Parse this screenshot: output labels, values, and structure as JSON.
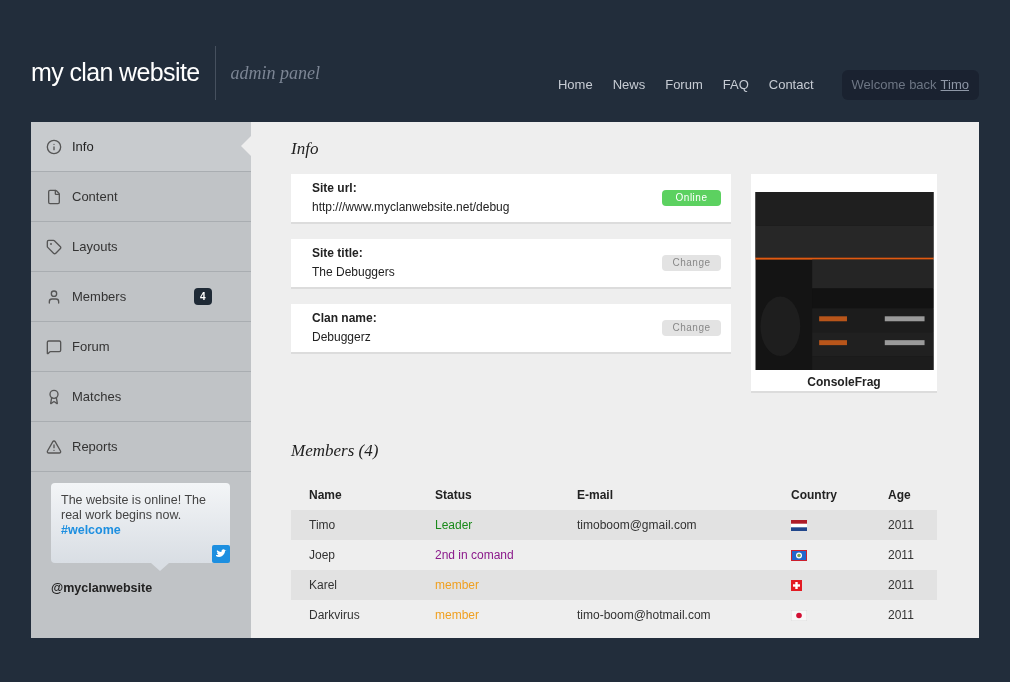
{
  "header": {
    "logo": {
      "prefix": "my",
      "bold": "clan",
      "suffix": "website"
    },
    "subtitle": "admin panel",
    "nav": [
      "Home",
      "News",
      "Forum",
      "FAQ",
      "Contact"
    ],
    "welcome": {
      "text": "Welcome back",
      "user": "Timo"
    }
  },
  "sidebar": {
    "items": [
      {
        "label": "Info",
        "selected": true
      },
      {
        "label": "Content",
        "selected": false
      },
      {
        "label": "Layouts",
        "selected": false
      },
      {
        "label": "Members",
        "selected": false,
        "badge": "4"
      },
      {
        "label": "Forum",
        "selected": false
      },
      {
        "label": "Matches",
        "selected": false
      },
      {
        "label": "Reports",
        "selected": false
      }
    ],
    "tweet": {
      "text": "The website is online! The real work begins now.",
      "hashtag": "#welcome",
      "handle": "@myclanwebsite"
    }
  },
  "info": {
    "title": "Info",
    "fields": [
      {
        "label": "Site url:",
        "value": "http:///www.myclanwebsite.net/debug",
        "action": "Online",
        "kind": "status"
      },
      {
        "label": "Site title:",
        "value": "The Debuggers",
        "action": "Change",
        "kind": "button"
      },
      {
        "label": "Clan name:",
        "value": "Debuggerz",
        "action": "Change",
        "kind": "button"
      }
    ],
    "preview": {
      "caption": "ConsoleFrag",
      "kind": "picture"
    }
  },
  "members": {
    "title": "Members (4)",
    "columns": [
      "Name",
      "Status",
      "E-mail",
      "Country",
      "Age"
    ],
    "rows": [
      {
        "name": "Timo",
        "status": "Leader",
        "color": "#1a8a1a",
        "email": "timoboom@gmail.com",
        "age": "2011"
      },
      {
        "name": "Joep",
        "status": "2nd in comand",
        "color": "#8b1a8b",
        "email": "",
        "age": "2011"
      },
      {
        "name": "Karel",
        "status": "member",
        "color": "#f0a020",
        "email": "",
        "age": "2011"
      },
      {
        "name": "Darkvirus",
        "status": "member",
        "color": "#f0a020",
        "email": "timo-boom@hotmail.com",
        "age": "2011"
      }
    ]
  }
}
